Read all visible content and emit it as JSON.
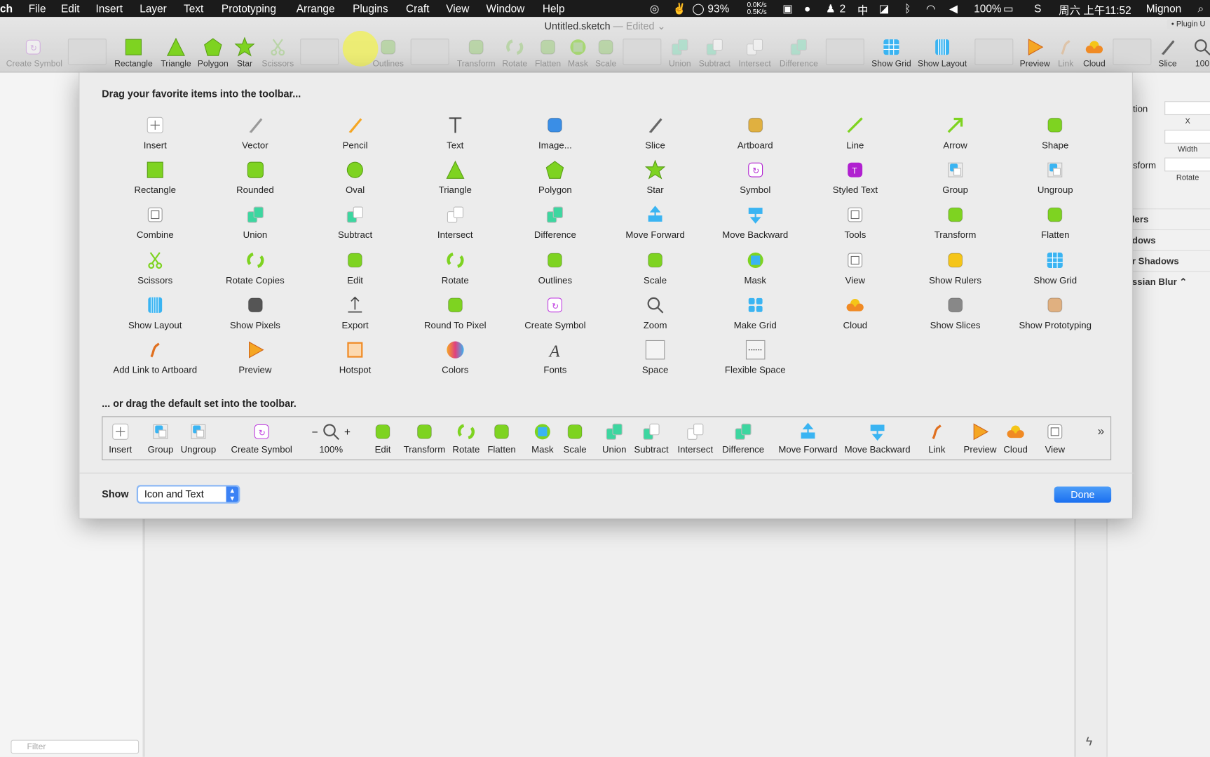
{
  "menubar": {
    "app": "ch",
    "items": [
      "File",
      "Edit",
      "Insert",
      "Layer",
      "Text",
      "Prototyping",
      "Arrange",
      "Plugins",
      "Craft",
      "View",
      "Window",
      "Help"
    ],
    "status": {
      "battery_ring": "93%",
      "net_up": "0.0K/s",
      "net_down": "0.5K/s",
      "qq_count": "2",
      "input_method": "中",
      "battery": "100%",
      "clock": "周六 上午11:52",
      "user": "Mignon"
    }
  },
  "window": {
    "title": "Untitled.sketch",
    "edited": "— Edited ⌄",
    "plugin_button": "• Plugin U"
  },
  "toolbar": {
    "items": [
      {
        "label": "Create Symbol",
        "icon": "symbol",
        "color": "#c98ae0",
        "dim": true
      },
      {
        "label": "Rectangle",
        "icon": "rect",
        "color": "#7ed321"
      },
      {
        "label": "Triangle",
        "icon": "triangle",
        "color": "#7ed321"
      },
      {
        "label": "Polygon",
        "icon": "pentagon",
        "color": "#7ed321"
      },
      {
        "label": "Star",
        "icon": "star",
        "color": "#7ed321"
      },
      {
        "label": "Scissors",
        "icon": "scissors",
        "color": "#9fcf7f",
        "dim": true
      },
      {
        "label": "Outlines",
        "icon": "outlines",
        "color": "#9fcf7f",
        "dim": true
      },
      {
        "label": "Transform",
        "icon": "transform",
        "color": "#9fcf7f",
        "dim": true
      },
      {
        "label": "Rotate",
        "icon": "rotate",
        "color": "#9fcf7f",
        "dim": true
      },
      {
        "label": "Flatten",
        "icon": "flatten",
        "color": "#9fcf7f",
        "dim": true
      },
      {
        "label": "Mask",
        "icon": "mask",
        "color": "#9fcf7f",
        "dim": true
      },
      {
        "label": "Scale",
        "icon": "scale",
        "color": "#9fcf7f",
        "dim": true
      },
      {
        "label": "Union",
        "icon": "union",
        "color": "#8fe0c0",
        "dim": true
      },
      {
        "label": "Subtract",
        "icon": "subtract",
        "color": "#8fe0c0",
        "dim": true
      },
      {
        "label": "Intersect",
        "icon": "intersect",
        "color": "#8fe0c0",
        "dim": true
      },
      {
        "label": "Difference",
        "icon": "difference",
        "color": "#8fe0c0",
        "dim": true
      },
      {
        "label": "Show Grid",
        "icon": "grid",
        "color": "#3ab4f2"
      },
      {
        "label": "Show Layout",
        "icon": "layout",
        "color": "#3ab4f2"
      },
      {
        "label": "Preview",
        "icon": "play",
        "color": "#f5a623"
      },
      {
        "label": "Link",
        "icon": "link",
        "color": "#e0b080",
        "dim": true
      },
      {
        "label": "Cloud",
        "icon": "cloud",
        "color": "#f08a24"
      },
      {
        "label": "Slice",
        "icon": "knife",
        "color": "#666"
      },
      {
        "label": "100",
        "icon": "zoom",
        "color": "#555"
      }
    ]
  },
  "dialog": {
    "heading1": "Drag your favorite items into the toolbar...",
    "heading2": "... or drag the default set into the toolbar.",
    "items": [
      {
        "label": "Insert",
        "icon": "plus",
        "color": "#888"
      },
      {
        "label": "Vector",
        "icon": "pen",
        "color": "#999"
      },
      {
        "label": "Pencil",
        "icon": "pencil",
        "color": "#f5a623"
      },
      {
        "label": "Text",
        "icon": "text",
        "color": "#444"
      },
      {
        "label": "Image...",
        "icon": "image",
        "color": "#3a8ee6"
      },
      {
        "label": "Slice",
        "icon": "knife",
        "color": "#666"
      },
      {
        "label": "Artboard",
        "icon": "artboard",
        "color": "#e0b040"
      },
      {
        "label": "Line",
        "icon": "line",
        "color": "#7ed321"
      },
      {
        "label": "Arrow",
        "icon": "arrow",
        "color": "#7ed321"
      },
      {
        "label": "Shape",
        "icon": "shape",
        "color": "#7ed321"
      },
      {
        "label": "Rectangle",
        "icon": "rect",
        "color": "#7ed321"
      },
      {
        "label": "Rounded",
        "icon": "rounded",
        "color": "#7ed321"
      },
      {
        "label": "Oval",
        "icon": "oval",
        "color": "#7ed321"
      },
      {
        "label": "Triangle",
        "icon": "triangle",
        "color": "#7ed321"
      },
      {
        "label": "Polygon",
        "icon": "pentagon",
        "color": "#7ed321"
      },
      {
        "label": "Star",
        "icon": "star",
        "color": "#7ed321"
      },
      {
        "label": "Symbol",
        "icon": "symbol",
        "color": "#b020d0"
      },
      {
        "label": "Styled Text",
        "icon": "styled-text",
        "color": "#b020d0"
      },
      {
        "label": "Group",
        "icon": "group",
        "color": "#3ab4f2"
      },
      {
        "label": "Ungroup",
        "icon": "ungroup",
        "color": "#3ab4f2"
      },
      {
        "label": "Combine",
        "icon": "combine",
        "color": "#666"
      },
      {
        "label": "Union",
        "icon": "union",
        "color": "#3dd6a0"
      },
      {
        "label": "Subtract",
        "icon": "subtract",
        "color": "#3dd6a0"
      },
      {
        "label": "Intersect",
        "icon": "intersect",
        "color": "#3dd6a0"
      },
      {
        "label": "Difference",
        "icon": "difference",
        "color": "#3dd6a0"
      },
      {
        "label": "Move Forward",
        "icon": "move-forward",
        "color": "#3ab4f2"
      },
      {
        "label": "Move Backward",
        "icon": "move-backward",
        "color": "#3ab4f2"
      },
      {
        "label": "Tools",
        "icon": "tools",
        "color": "#666"
      },
      {
        "label": "Transform",
        "icon": "transform",
        "color": "#7ed321"
      },
      {
        "label": "Flatten",
        "icon": "flatten",
        "color": "#7ed321"
      },
      {
        "label": "Scissors",
        "icon": "scissors",
        "color": "#7ed321"
      },
      {
        "label": "Rotate Copies",
        "icon": "rotate-copies",
        "color": "#7ed321"
      },
      {
        "label": "Edit",
        "icon": "edit",
        "color": "#7ed321"
      },
      {
        "label": "Rotate",
        "icon": "rotate",
        "color": "#7ed321"
      },
      {
        "label": "Outlines",
        "icon": "outlines",
        "color": "#7ed321"
      },
      {
        "label": "Scale",
        "icon": "scale",
        "color": "#7ed321"
      },
      {
        "label": "Mask",
        "icon": "mask",
        "color": "#3ab4f2"
      },
      {
        "label": "View",
        "icon": "view",
        "color": "#666"
      },
      {
        "label": "Show Rulers",
        "icon": "rulers",
        "color": "#f5c518"
      },
      {
        "label": "Show Grid",
        "icon": "grid",
        "color": "#3ab4f2"
      },
      {
        "label": "Show Layout",
        "icon": "layout",
        "color": "#3ab4f2"
      },
      {
        "label": "Show Pixels",
        "icon": "pixels",
        "color": "#555"
      },
      {
        "label": "Export",
        "icon": "export",
        "color": "#444"
      },
      {
        "label": "Round To Pixel",
        "icon": "round-pixel",
        "color": "#7ed321"
      },
      {
        "label": "Create Symbol",
        "icon": "symbol",
        "color": "#c040e0"
      },
      {
        "label": "Zoom",
        "icon": "zoom",
        "color": "#555"
      },
      {
        "label": "Make Grid",
        "icon": "make-grid",
        "color": "#3ab4f2"
      },
      {
        "label": "Cloud",
        "icon": "cloud",
        "color": "#f08a24"
      },
      {
        "label": "Show Slices",
        "icon": "slices",
        "color": "#888"
      },
      {
        "label": "Show Prototyping",
        "icon": "prototyping",
        "color": "#e0b080"
      },
      {
        "label": "Add Link to Artboard",
        "icon": "link",
        "color": "#e07020"
      },
      {
        "label": "Preview",
        "icon": "play",
        "color": "#f5a623"
      },
      {
        "label": "Hotspot",
        "icon": "hotspot",
        "color": "#f08a24"
      },
      {
        "label": "Colors",
        "icon": "colors",
        "color": "#e04080"
      },
      {
        "label": "Fonts",
        "icon": "fonts",
        "color": "#444"
      },
      {
        "label": "Space",
        "icon": "space",
        "color": "#888"
      },
      {
        "label": "Flexible Space",
        "icon": "flexible-space",
        "color": "#888"
      }
    ],
    "default_set": [
      {
        "label": "Insert",
        "icon": "plus",
        "color": "#888"
      },
      {
        "label": "Group",
        "icon": "group",
        "color": "#3ab4f2"
      },
      {
        "label": "Ungroup",
        "icon": "ungroup",
        "color": "#3ab4f2"
      },
      {
        "label": "Create Symbol",
        "icon": "symbol",
        "color": "#c040e0"
      },
      {
        "label": "100%",
        "icon": "zoom",
        "color": "#555"
      },
      {
        "label": "Edit",
        "icon": "edit",
        "color": "#7ed321"
      },
      {
        "label": "Transform",
        "icon": "transform",
        "color": "#7ed321"
      },
      {
        "label": "Rotate",
        "icon": "rotate",
        "color": "#7ed321"
      },
      {
        "label": "Flatten",
        "icon": "flatten",
        "color": "#7ed321"
      },
      {
        "label": "Mask",
        "icon": "mask",
        "color": "#3ab4f2"
      },
      {
        "label": "Scale",
        "icon": "scale",
        "color": "#7ed321"
      },
      {
        "label": "Union",
        "icon": "union",
        "color": "#3dd6a0"
      },
      {
        "label": "Subtract",
        "icon": "subtract",
        "color": "#3dd6a0"
      },
      {
        "label": "Intersect",
        "icon": "intersect",
        "color": "#3dd6a0"
      },
      {
        "label": "Difference",
        "icon": "difference",
        "color": "#3dd6a0"
      },
      {
        "label": "Move Forward",
        "icon": "move-forward",
        "color": "#3ab4f2"
      },
      {
        "label": "Move Backward",
        "icon": "move-backward",
        "color": "#3ab4f2"
      },
      {
        "label": "Link",
        "icon": "link",
        "color": "#e07020"
      },
      {
        "label": "Preview",
        "icon": "play",
        "color": "#f5a623"
      },
      {
        "label": "Cloud",
        "icon": "cloud",
        "color": "#f08a24"
      },
      {
        "label": "View",
        "icon": "view",
        "color": "#666"
      }
    ],
    "overflow": "»",
    "show_label": "Show",
    "show_value": "Icon and Text",
    "done": "Done"
  },
  "inspector": {
    "position": "tion",
    "x": "X",
    "width": "Width",
    "transform": "sform",
    "rotate": "Rotate",
    "sections": [
      "lers",
      "dows",
      "r Shadows",
      "ssian Blur ⌃"
    ]
  },
  "sidebar": {
    "filter_placeholder": "Filter"
  }
}
